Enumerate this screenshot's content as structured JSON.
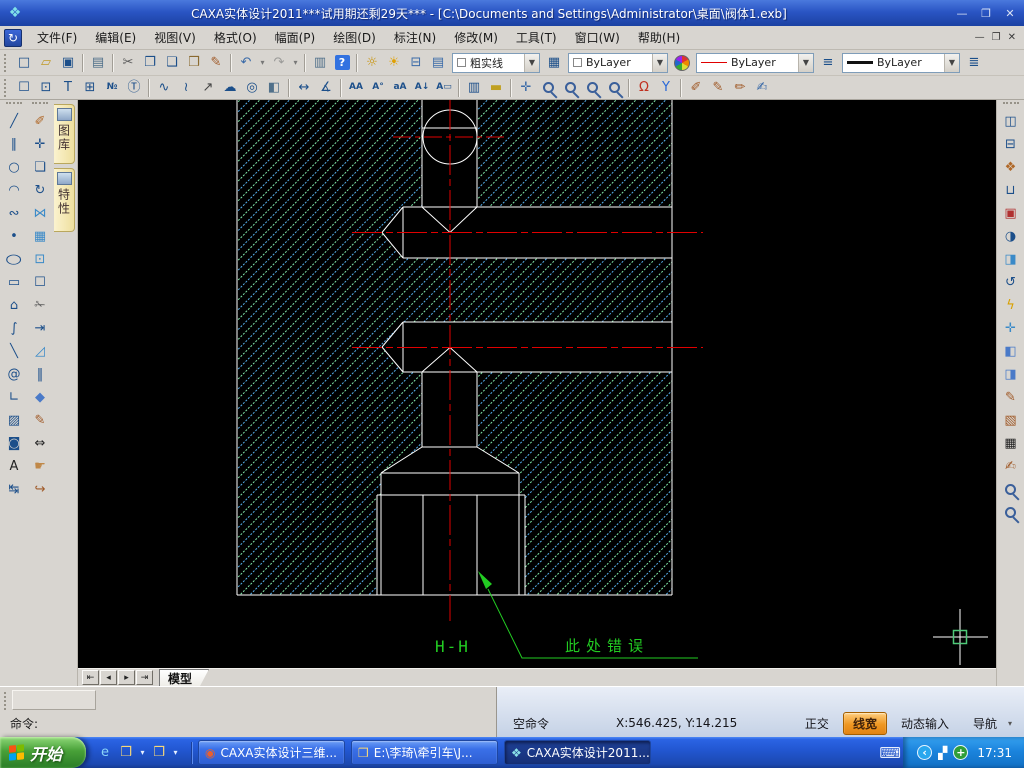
{
  "colors": {
    "red": "#e00000",
    "green": "#22cc22",
    "white": "#ffffff",
    "hatch-green": "#82e8aa",
    "hatch-cyan": "#58b2ee",
    "pickbox": "#4ec878"
  },
  "window": {
    "title": "CAXA实体设计2011***试用期还剩29天*** - [C:\\Documents and Settings\\Administrator\\桌面\\阀体1.exb]",
    "minimize": "—",
    "restore": "❐",
    "close": "✕",
    "app_glyph": "❖",
    "mdi_glyph": "↻"
  },
  "menu": {
    "items": [
      {
        "name": "menu-file",
        "label": "文件(F)"
      },
      {
        "name": "menu-edit",
        "label": "编辑(E)"
      },
      {
        "name": "menu-view",
        "label": "视图(V)"
      },
      {
        "name": "menu-format",
        "label": "格式(O)"
      },
      {
        "name": "menu-paper",
        "label": "幅面(P)"
      },
      {
        "name": "menu-draw",
        "label": "绘图(D)"
      },
      {
        "name": "menu-dimension",
        "label": "标注(N)"
      },
      {
        "name": "menu-modify",
        "label": "修改(M)"
      },
      {
        "name": "menu-tools",
        "label": "工具(T)"
      },
      {
        "name": "menu-window",
        "label": "窗口(W)"
      },
      {
        "name": "menu-help",
        "label": "帮助(H)"
      }
    ]
  },
  "toolbar1": {
    "itemsA": [
      {
        "name": "new-file-button",
        "glyph": "□"
      },
      {
        "name": "open-file-button",
        "glyph": "▱",
        "color": "#c09a28"
      },
      {
        "name": "save-button",
        "glyph": "▣"
      },
      {
        "name": "separator",
        "cls": "sep"
      },
      {
        "name": "print-button",
        "glyph": "▤",
        "color": "#50708a"
      },
      {
        "name": "separator",
        "cls": "sep"
      },
      {
        "name": "cut-button",
        "glyph": "✂",
        "color": "#5a5a5a"
      },
      {
        "name": "copy-button",
        "glyph": "❐"
      },
      {
        "name": "copy-basepoint-button",
        "glyph": "❑"
      },
      {
        "name": "paste-button",
        "glyph": "❒",
        "color": "#8a6a30"
      },
      {
        "name": "format-painter-button",
        "glyph": "✎",
        "color": "#a05a28"
      },
      {
        "name": "separator",
        "cls": "sep"
      },
      {
        "name": "undo-button",
        "glyph": "↶",
        "color": "#3a6aa8"
      },
      {
        "name": "undo-dropdown",
        "glyph": "▾",
        "cls": "dd2",
        "color": "#777777"
      },
      {
        "name": "redo-button",
        "glyph": "↷",
        "color": "#9a9a98"
      },
      {
        "name": "redo-dropdown",
        "glyph": "▾",
        "cls": "dd2",
        "color": "#777777"
      },
      {
        "name": "separator",
        "cls": "sep"
      },
      {
        "name": "insert-object-button",
        "glyph": "▥",
        "color": "#50708a"
      },
      {
        "name": "help-button",
        "glyph": "?",
        "cls": "boxed"
      },
      {
        "name": "separator",
        "cls": "sep"
      },
      {
        "name": "layer-visibility-button",
        "glyph": "☼",
        "color": "#c89000"
      },
      {
        "name": "layer-brightness-button",
        "glyph": "☀",
        "color": "#e0a000"
      },
      {
        "name": "layer-lock-button",
        "glyph": "⊟",
        "color": "#3a6aa8"
      },
      {
        "name": "layer-print-button",
        "glyph": "▤",
        "color": "#3a6aa8"
      }
    ],
    "combo_linestyle": {
      "value": "粗实线"
    },
    "layer_manager_glyph": "▦",
    "combo_layer": {
      "value": "ByLayer"
    },
    "combo_linetype": {
      "value": "ByLayer"
    },
    "linetype_manager_glyph": "≡",
    "combo_lineweight": {
      "value": "ByLayer"
    },
    "lineweight_glyph": "≣"
  },
  "toolbar2": {
    "items": [
      {
        "name": "select-window-button",
        "glyph": "☐"
      },
      {
        "name": "zoom-display-button",
        "glyph": "⊡"
      },
      {
        "name": "viewport-text-button",
        "glyph": "T"
      },
      {
        "name": "insert-table-button",
        "glyph": "⊞"
      },
      {
        "name": "sequence-number-button",
        "glyph": "№",
        "cls": "sm"
      },
      {
        "name": "text-block-button",
        "glyph": "Ⓣ"
      },
      {
        "name": "separator",
        "cls": "sep"
      },
      {
        "name": "wave-line-button",
        "glyph": "∿"
      },
      {
        "name": "break-line-button",
        "glyph": "≀"
      },
      {
        "name": "leader-arrow-button",
        "glyph": "↗",
        "color": "#444444"
      },
      {
        "name": "revision-cloud-button",
        "glyph": "☁"
      },
      {
        "name": "symbol-stamp-button",
        "glyph": "◎"
      },
      {
        "name": "solid-fill-button",
        "glyph": "◧",
        "color": "#50708a"
      },
      {
        "name": "separator",
        "cls": "sep"
      },
      {
        "name": "dim-linear-button",
        "glyph": "↔"
      },
      {
        "name": "dim-coordinate-button",
        "glyph": "∡"
      },
      {
        "name": "separator",
        "cls": "sep"
      },
      {
        "name": "text-find-button",
        "glyph": "AA",
        "cls": "sm"
      },
      {
        "name": "text-angle-button",
        "glyph": "A°",
        "cls": "sm"
      },
      {
        "name": "char-map-button",
        "glyph": "aA",
        "cls": "sm"
      },
      {
        "name": "text-align-button",
        "glyph": "A↓",
        "cls": "sm"
      },
      {
        "name": "text-ruler-button",
        "glyph": "A▭",
        "cls": "sm"
      },
      {
        "name": "separator",
        "cls": "sep"
      },
      {
        "name": "display-config-button",
        "glyph": "▥"
      },
      {
        "name": "measure-ruler-button",
        "glyph": "▬",
        "color": "#c0a020"
      },
      {
        "name": "separator",
        "cls": "sep"
      },
      {
        "name": "pan-button",
        "glyph": "✛",
        "color": "#3a6aa8"
      },
      {
        "name": "zoom-in-button",
        "glyph": "",
        "cls": "mag"
      },
      {
        "name": "zoom-window-button",
        "glyph": "",
        "cls": "mag"
      },
      {
        "name": "zoom-all-button",
        "glyph": "",
        "cls": "mag"
      },
      {
        "name": "zoom-previous-button",
        "glyph": "",
        "cls": "mag"
      },
      {
        "name": "separator",
        "cls": "sep"
      },
      {
        "name": "snap-magnet-button",
        "glyph": "Ω",
        "color": "#c03020"
      },
      {
        "name": "snap-guide-button",
        "glyph": "Y",
        "color": "#2868d8"
      },
      {
        "name": "separator",
        "cls": "sep"
      },
      {
        "name": "edit-brush-button",
        "glyph": "✐",
        "color": "#a05a28"
      },
      {
        "name": "text-brush-button",
        "glyph": "✎",
        "color": "#a05a28"
      },
      {
        "name": "curve-brush-button",
        "glyph": "✏",
        "color": "#a05a28"
      },
      {
        "name": "property-edit-button",
        "glyph": "✍",
        "color": "#3a6aa8"
      }
    ]
  },
  "left_toolbox": {
    "col1": [
      {
        "name": "line-tool",
        "glyph": "╱"
      },
      {
        "name": "parallel-line-tool",
        "glyph": "∥"
      },
      {
        "name": "circle-tool",
        "glyph": "○"
      },
      {
        "name": "arc-tool",
        "glyph": "◠"
      },
      {
        "name": "spline-tool",
        "glyph": "∾"
      },
      {
        "name": "point-tool",
        "glyph": "•"
      },
      {
        "name": "ellipse-tool",
        "glyph": "○",
        "cls": "wide"
      },
      {
        "name": "rectangle-tool",
        "glyph": "▭"
      },
      {
        "name": "polygon-tool",
        "glyph": "⌂"
      },
      {
        "name": "bezier-tool",
        "glyph": "∫"
      },
      {
        "name": "offset-line-tool",
        "glyph": "╲"
      },
      {
        "name": "formula-curve-tool",
        "glyph": "@",
        "cls": "sm"
      },
      {
        "name": "profile-tool",
        "glyph": "∟"
      },
      {
        "name": "hatch-tool",
        "glyph": "▨"
      },
      {
        "name": "region-fill-tool",
        "glyph": "◙"
      },
      {
        "name": "text-tool",
        "glyph": "A",
        "color": "#222222"
      },
      {
        "name": "dimension-tool",
        "glyph": "↹"
      }
    ],
    "col2": [
      {
        "name": "erase-tool",
        "glyph": "✐",
        "color": "#b06828"
      },
      {
        "name": "move-tool",
        "glyph": "✛"
      },
      {
        "name": "copy-tool",
        "glyph": "❏"
      },
      {
        "name": "rotate-tool",
        "glyph": "↻"
      },
      {
        "name": "mirror-tool",
        "glyph": "⋈",
        "color": "#3a8ac8"
      },
      {
        "name": "array-tool",
        "glyph": "▦",
        "color": "#3a8ac8"
      },
      {
        "name": "scale-tool",
        "glyph": "⊡",
        "color": "#3a8ac8"
      },
      {
        "name": "select-tool",
        "glyph": "☐"
      },
      {
        "name": "trim-tool",
        "glyph": "✁",
        "color": "#5a5a5a"
      },
      {
        "name": "extend-tool",
        "glyph": "⇥"
      },
      {
        "name": "corner-tool",
        "glyph": "◿",
        "color": "#3a8ac8"
      },
      {
        "name": "break-tool",
        "glyph": "‖"
      },
      {
        "name": "view-3d-tool",
        "glyph": "◆",
        "color": "#4a7ac8"
      },
      {
        "name": "dim-edit-tool",
        "glyph": "✎",
        "color": "#a05a28"
      },
      {
        "name": "stretch-tool",
        "glyph": "⇔",
        "color": "#222222"
      },
      {
        "name": "drag-hand-tool",
        "glyph": "☛",
        "color": "#c08848"
      },
      {
        "name": "exb-export-tool",
        "glyph": "↪",
        "color": "#a05a28"
      }
    ],
    "tabs": [
      {
        "name": "flyout-tab-library",
        "label": "图库"
      },
      {
        "name": "flyout-tab-properties",
        "label": "特性"
      }
    ]
  },
  "right_toolbox": {
    "items": [
      {
        "name": "new-view-button",
        "glyph": "◫"
      },
      {
        "name": "tile-view-button",
        "glyph": "⊟"
      },
      {
        "name": "render-button",
        "glyph": "❖",
        "color": "#b06828"
      },
      {
        "name": "bench-button",
        "glyph": "⊔"
      },
      {
        "name": "photo-view-button",
        "glyph": "▣",
        "color": "#b03030"
      },
      {
        "name": "section-view-button",
        "glyph": "◑"
      },
      {
        "name": "split-view-button",
        "glyph": "◨",
        "color": "#3a8ac8"
      },
      {
        "name": "rotate-view-button",
        "glyph": "↺"
      },
      {
        "name": "quick-render-button",
        "glyph": "ϟ",
        "color": "#d8a000"
      },
      {
        "name": "node-move-button",
        "glyph": "✛",
        "color": "#3a8ac8"
      },
      {
        "name": "panel-left-button",
        "glyph": "◧",
        "color": "#4a7ac8"
      },
      {
        "name": "panel-right-button",
        "glyph": "◨",
        "color": "#4a7ac8"
      },
      {
        "name": "sketch-note-button",
        "glyph": "✎",
        "color": "#a05a28"
      },
      {
        "name": "hatch-edit-button",
        "glyph": "▧",
        "color": "#a05a28"
      },
      {
        "name": "bom-table-button",
        "glyph": "▦",
        "color": "#222222"
      },
      {
        "name": "note-flash-button",
        "glyph": "✍",
        "color": "#a05a28"
      },
      {
        "name": "zoom-part-button",
        "glyph": "",
        "cls": "mag"
      },
      {
        "name": "zoom-assembly-button",
        "glyph": "",
        "cls": "mag"
      }
    ]
  },
  "canvas": {
    "section_label": "H-H",
    "annotation": "此处错误"
  },
  "sheet": {
    "nav": [
      {
        "name": "first-sheet-button",
        "glyph": "⇤"
      },
      {
        "name": "prev-sheet-button",
        "glyph": "◂"
      },
      {
        "name": "next-sheet-button",
        "glyph": "▸"
      },
      {
        "name": "last-sheet-button",
        "glyph": "⇥"
      }
    ],
    "active_tab": "模型"
  },
  "command": {
    "prompt": "命令:"
  },
  "status": {
    "mode": "空命令",
    "coords": "X:546.425, Y:14.215",
    "toggles": [
      {
        "name": "ortho-toggle",
        "label": "正交"
      },
      {
        "name": "lineweight-toggle",
        "label": "线宽",
        "active": true
      },
      {
        "name": "dynamic-input-toggle",
        "label": "动态输入"
      },
      {
        "name": "navigation-toggle",
        "label": "导航"
      }
    ],
    "nav_arrow": "▾"
  },
  "taskbar": {
    "start_label": "开始",
    "quick_launch": [
      {
        "name": "ie-quicklaunch",
        "glyph": "e",
        "color": "#8ad4f8"
      },
      {
        "name": "folder-quicklaunch-1",
        "glyph": "❒",
        "color": "#f8d878"
      },
      {
        "name": "quicklaunch-dropdown-1",
        "glyph": "▾",
        "cls": "dd2",
        "color": "#e8f0ff"
      },
      {
        "name": "folder-quicklaunch-2",
        "glyph": "❒",
        "color": "#f8d878"
      },
      {
        "name": "quicklaunch-dropdown-2",
        "glyph": "▾",
        "cls": "dd2",
        "color": "#e8f0ff"
      }
    ],
    "tasks": [
      {
        "name": "task-caxa-3d",
        "label": "CAXA实体设计三维...",
        "icon": "◉",
        "icon_color": "#e86030"
      },
      {
        "name": "task-explorer-folder",
        "label": "E:\\李琦\\牵引车\\J...",
        "icon": "❒",
        "icon_color": "#f8d878"
      },
      {
        "name": "task-caxa-2011",
        "label": "CAXA实体设计2011...",
        "icon": "❖",
        "icon_color": "#8ae0e8",
        "active": true
      }
    ],
    "tray": {
      "keyboard": "⌨",
      "restore": "‹",
      "network": "▞",
      "update": "+",
      "time": "17:31"
    }
  }
}
